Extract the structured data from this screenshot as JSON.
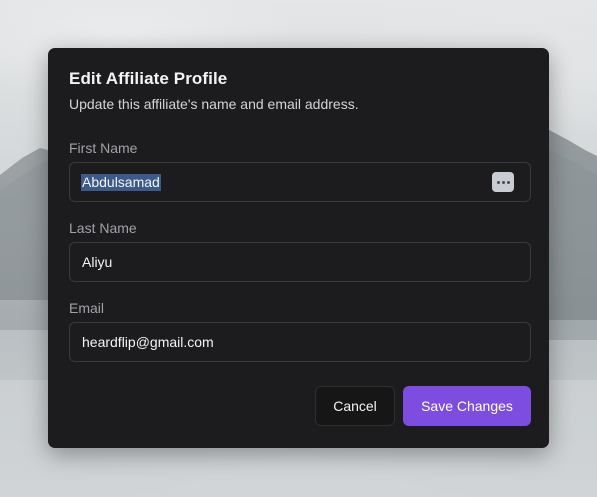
{
  "dialog": {
    "title": "Edit Affiliate Profile",
    "subtitle": "Update this affiliate's name and email address."
  },
  "form": {
    "first_name": {
      "label": "First Name",
      "value": "Abdulsamad",
      "autofill_icon": "more-dots-icon"
    },
    "last_name": {
      "label": "Last Name",
      "value": "Aliyu"
    },
    "email": {
      "label": "Email",
      "value": "heardflip@gmail.com"
    }
  },
  "actions": {
    "cancel_label": "Cancel",
    "save_label": "Save Changes"
  },
  "colors": {
    "dialog_bg": "#1c1c1e",
    "accent": "#7c4ddf",
    "selection": "#3b5a87"
  }
}
